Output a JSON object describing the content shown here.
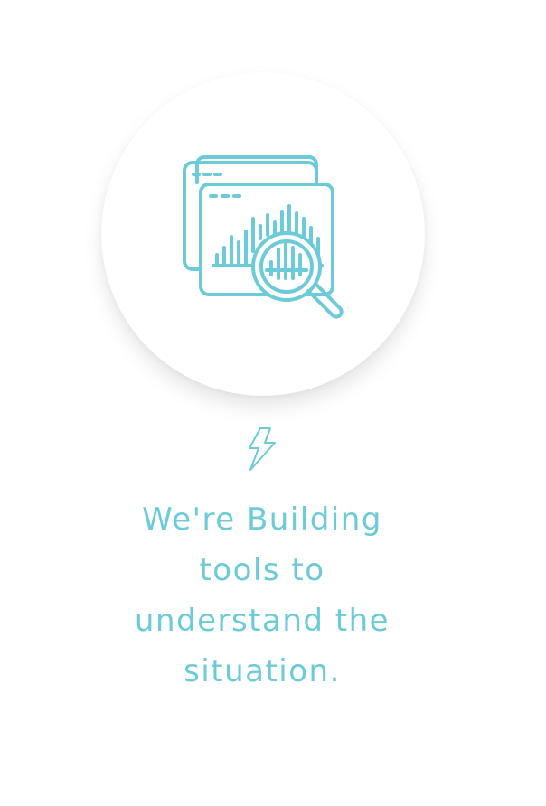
{
  "feature": {
    "hero_icon": "analytics-magnifier-icon",
    "accent_icon": "lightning-bolt-icon",
    "headline_lines": [
      "We're Building",
      "tools to",
      "understand the",
      "situation."
    ]
  },
  "colors": {
    "accent": "#6ccbd9",
    "background": "#ffffff"
  }
}
